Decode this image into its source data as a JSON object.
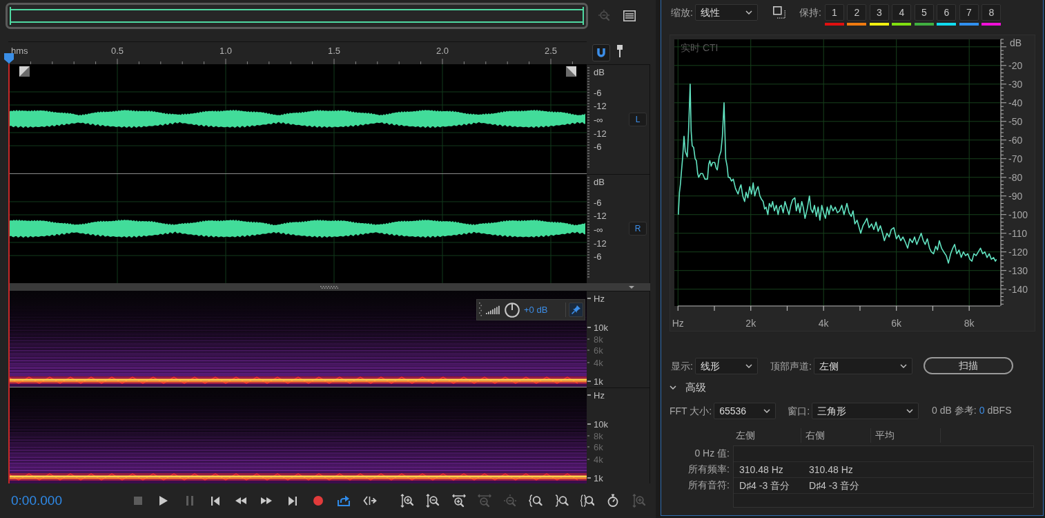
{
  "overview_tools": [
    {
      "kind": "zoom",
      "disabled": true
    },
    {
      "kind": "list",
      "disabled": false
    }
  ],
  "timeline": {
    "labels": [
      "hms",
      "0.5",
      "1.0",
      "1.5",
      "2.0",
      "2.5"
    ],
    "snapping": true
  },
  "waveform": {
    "channels": [
      {
        "label": "L",
        "scale": [
          "dB",
          "-6",
          "-12",
          "-∞",
          "-12",
          "-6"
        ]
      },
      {
        "label": "R",
        "scale": [
          "dB",
          "-6",
          "-12",
          "-∞",
          "-12",
          "-6"
        ]
      }
    ]
  },
  "spectral": {
    "gain": "+0 dB",
    "pinned": true,
    "channels": [
      {
        "scale": [
          {
            "text": "Hz",
            "major": true
          },
          {
            "text": "10k",
            "major": true
          },
          {
            "text": "8k",
            "major": false
          },
          {
            "text": "6k",
            "major": false
          },
          {
            "text": "4k",
            "major": false
          },
          {
            "text": "1k",
            "major": true
          }
        ]
      },
      {
        "scale": [
          {
            "text": "Hz",
            "major": true
          },
          {
            "text": "10k",
            "major": true
          },
          {
            "text": "8k",
            "major": false
          },
          {
            "text": "6k",
            "major": false
          },
          {
            "text": "4k",
            "major": false
          },
          {
            "text": "1k",
            "major": true
          }
        ]
      }
    ]
  },
  "transport": {
    "time": "0:00.000",
    "buttons": [
      {
        "kind": "stop",
        "disabled": true,
        "on": false
      },
      {
        "kind": "play",
        "disabled": false,
        "on": false
      },
      {
        "kind": "pause",
        "disabled": true,
        "on": false
      },
      {
        "kind": "start",
        "disabled": false,
        "on": false
      },
      {
        "kind": "rewind",
        "disabled": false,
        "on": false
      },
      {
        "kind": "forward",
        "disabled": false,
        "on": false
      },
      {
        "kind": "end",
        "disabled": false,
        "on": false
      },
      {
        "kind": "record",
        "disabled": false,
        "on": false
      },
      {
        "kind": "loop",
        "disabled": false,
        "on": true
      },
      {
        "kind": "skip",
        "disabled": false,
        "on": false
      }
    ],
    "zoom_buttons": [
      {
        "kind": "amp_in",
        "disabled": false
      },
      {
        "kind": "amp_out",
        "disabled": false
      },
      {
        "kind": "time_in",
        "disabled": false
      },
      {
        "kind": "time_out",
        "disabled": true
      },
      {
        "kind": "full_out",
        "disabled": true
      },
      {
        "kind": "in_start",
        "disabled": false
      },
      {
        "kind": "in_end",
        "disabled": false
      },
      {
        "kind": "selection",
        "disabled": false
      },
      {
        "kind": "reset",
        "disabled": false
      },
      {
        "kind": "track",
        "disabled": true
      }
    ]
  },
  "analysis": {
    "scale": {
      "label": "缩放:",
      "value": "线性"
    },
    "hold": {
      "label": "保持:",
      "slots": [
        {
          "label": "1",
          "color": "#e01010"
        },
        {
          "label": "2",
          "color": "#f07a10"
        },
        {
          "label": "3",
          "color": "#f2f010"
        },
        {
          "label": "4",
          "color": "#80e010"
        },
        {
          "label": "5",
          "color": "#40b040"
        },
        {
          "label": "6",
          "color": "#10dcf0"
        },
        {
          "label": "7",
          "color": "#3090f0"
        },
        {
          "label": "8",
          "color": "#f010d8"
        }
      ]
    },
    "chart_data": {
      "type": "line",
      "title": "实时 CTI",
      "ylabel": "dB",
      "grid": true,
      "x": [
        10,
        40,
        65,
        100,
        130,
        166,
        200,
        255,
        290,
        335,
        360,
        390,
        430,
        470,
        505,
        540,
        570,
        620,
        675,
        740,
        810,
        845,
        875,
        910,
        950,
        1010,
        1050,
        1080,
        1130,
        1180,
        1220,
        1265,
        1310,
        1350,
        1380,
        1420,
        1470,
        1520,
        1580,
        1650,
        1690,
        1730,
        1780,
        1830,
        1870,
        1920,
        1970,
        2020,
        2065,
        2110,
        2150,
        2200,
        2250,
        2300,
        2340,
        2380,
        2420,
        2470,
        2510,
        2560,
        2600,
        2650,
        2700,
        2750,
        2790,
        2840,
        2890,
        2940,
        3000,
        3050,
        3100,
        3150,
        3210,
        3250,
        3300,
        3350,
        3400,
        3440,
        3490,
        3550,
        3610,
        3650,
        3700,
        3750,
        3800,
        3850,
        3900,
        3950,
        4000,
        4050,
        4100,
        4150,
        4200,
        4260,
        4320,
        4380,
        4440,
        4500,
        4560,
        4640,
        4700,
        4760,
        4810,
        4860,
        4920,
        5020,
        5080,
        5140,
        5190,
        5250,
        5320,
        5380,
        5440,
        5500,
        5560,
        5620,
        5670,
        5740,
        5800,
        5860,
        5930,
        6000,
        6060,
        6120,
        6180,
        6250,
        6310,
        6370,
        6440,
        6500,
        6560,
        6620,
        6680,
        6740,
        6790,
        6850,
        6910,
        6960,
        7020,
        7080,
        7130,
        7180,
        7240,
        7300,
        7370,
        7430,
        7490,
        7550,
        7600,
        7660,
        7720,
        7780,
        7840,
        7900,
        7960,
        8020,
        8075,
        8130,
        8190,
        8250,
        8310,
        8370,
        8430,
        8490,
        8550,
        8610,
        8670,
        8720,
        8750
      ],
      "series": [
        {
          "color": "#62e4c2",
          "values": [
            -100,
            -88,
            -84,
            -76,
            -69,
            -58,
            -66,
            -69,
            -55,
            -30,
            -55,
            -63,
            -64,
            -70,
            -71,
            -78,
            -80,
            -78,
            -78,
            -81,
            -81,
            -73,
            -71,
            -74,
            -72,
            -72,
            -75,
            -76,
            -69,
            -66,
            -58,
            -40,
            -70,
            -74,
            -80,
            -80,
            -82,
            -81,
            -86,
            -89,
            -86,
            -84,
            -90,
            -93,
            -88,
            -91,
            -85,
            -89,
            -83,
            -90,
            -87,
            -85,
            -90,
            -92,
            -93,
            -97,
            -96,
            -100,
            -94,
            -96,
            -93,
            -98,
            -95,
            -100,
            -96,
            -95,
            -99,
            -93,
            -97,
            -100,
            -95,
            -92,
            -91,
            -98,
            -94,
            -99,
            -93,
            -96,
            -102,
            -97,
            -90,
            -97,
            -99,
            -95,
            -101,
            -96,
            -103,
            -95,
            -99,
            -102,
            -96,
            -100,
            -95,
            -98,
            -96,
            -99,
            -98,
            -95,
            -100,
            -94,
            -99,
            -101,
            -98,
            -105,
            -103,
            -110,
            -106,
            -104,
            -102,
            -107,
            -105,
            -108,
            -104,
            -109,
            -106,
            -110,
            -114,
            -110,
            -112,
            -108,
            -107,
            -113,
            -111,
            -114,
            -112,
            -115,
            -118,
            -113,
            -115,
            -112,
            -116,
            -113,
            -110,
            -114,
            -116,
            -113,
            -118,
            -120,
            -121,
            -117,
            -119,
            -114,
            -118,
            -120,
            -122,
            -126,
            -121,
            -118,
            -116,
            -121,
            -119,
            -123,
            -120,
            -122,
            -121,
            -124,
            -125,
            -121,
            -122,
            -120,
            -118,
            -121,
            -120,
            -123,
            -121,
            -124,
            -123,
            -125,
            -124
          ]
        }
      ],
      "xlim": [
        -100,
        8850
      ],
      "ylim": [
        -149,
        -6
      ],
      "xticks": [
        {
          "value": 0,
          "label": "Hz"
        },
        {
          "value": 2000,
          "label": "2k"
        },
        {
          "value": 4000,
          "label": "4k"
        },
        {
          "value": 6000,
          "label": "6k"
        },
        {
          "value": 8000,
          "label": "8k"
        }
      ],
      "yticks": [
        -20,
        -30,
        -40,
        -50,
        -60,
        -70,
        -80,
        -90,
        -100,
        -110,
        -120,
        -130,
        -140
      ]
    },
    "display": {
      "label": "显示:",
      "value": "线形"
    },
    "top_channel": {
      "label": "顶部声道:",
      "value": "左侧"
    },
    "scan_button": {
      "label": "扫描"
    },
    "advanced": {
      "label": "高级",
      "expanded": true
    },
    "fft_size": {
      "label": "FFT 大小:",
      "value": "65536"
    },
    "window": {
      "label": "窗口:",
      "value": "三角形"
    },
    "reference": {
      "label": "0 dB 参考:",
      "value": "0",
      "unit": "dBFS"
    },
    "results": {
      "columns": [
        "左侧",
        "右侧",
        "平均"
      ],
      "rows": [
        {
          "label": "0 Hz 值:"
        },
        {
          "label": "所有频率:",
          "cells": [
            "310.48 Hz",
            "310.48 Hz"
          ]
        },
        {
          "label": "所有音符:",
          "cells": [
            "D♯4 -3 音分",
            "D♯4 -3 音分"
          ]
        }
      ]
    }
  }
}
